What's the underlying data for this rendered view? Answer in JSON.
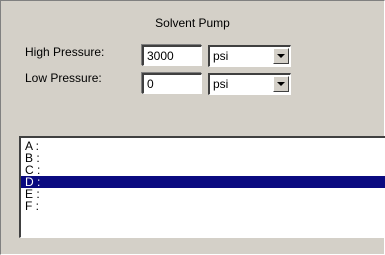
{
  "panel": {
    "title": "Solvent Pump"
  },
  "high_pressure": {
    "label": "High Pressure:",
    "value": "3000",
    "unit": "psi"
  },
  "low_pressure": {
    "label": "Low Pressure:",
    "value": "0",
    "unit": "psi"
  },
  "solvent_list": {
    "items": [
      "A :",
      "B :",
      "C :",
      "D :",
      "E :",
      "F :"
    ],
    "selected": "D :"
  },
  "colors": {
    "panel_bg": "#d4d0c8",
    "selection_bg": "#0a0a80"
  },
  "icons": {
    "dropdown": "chevron-down-icon"
  }
}
